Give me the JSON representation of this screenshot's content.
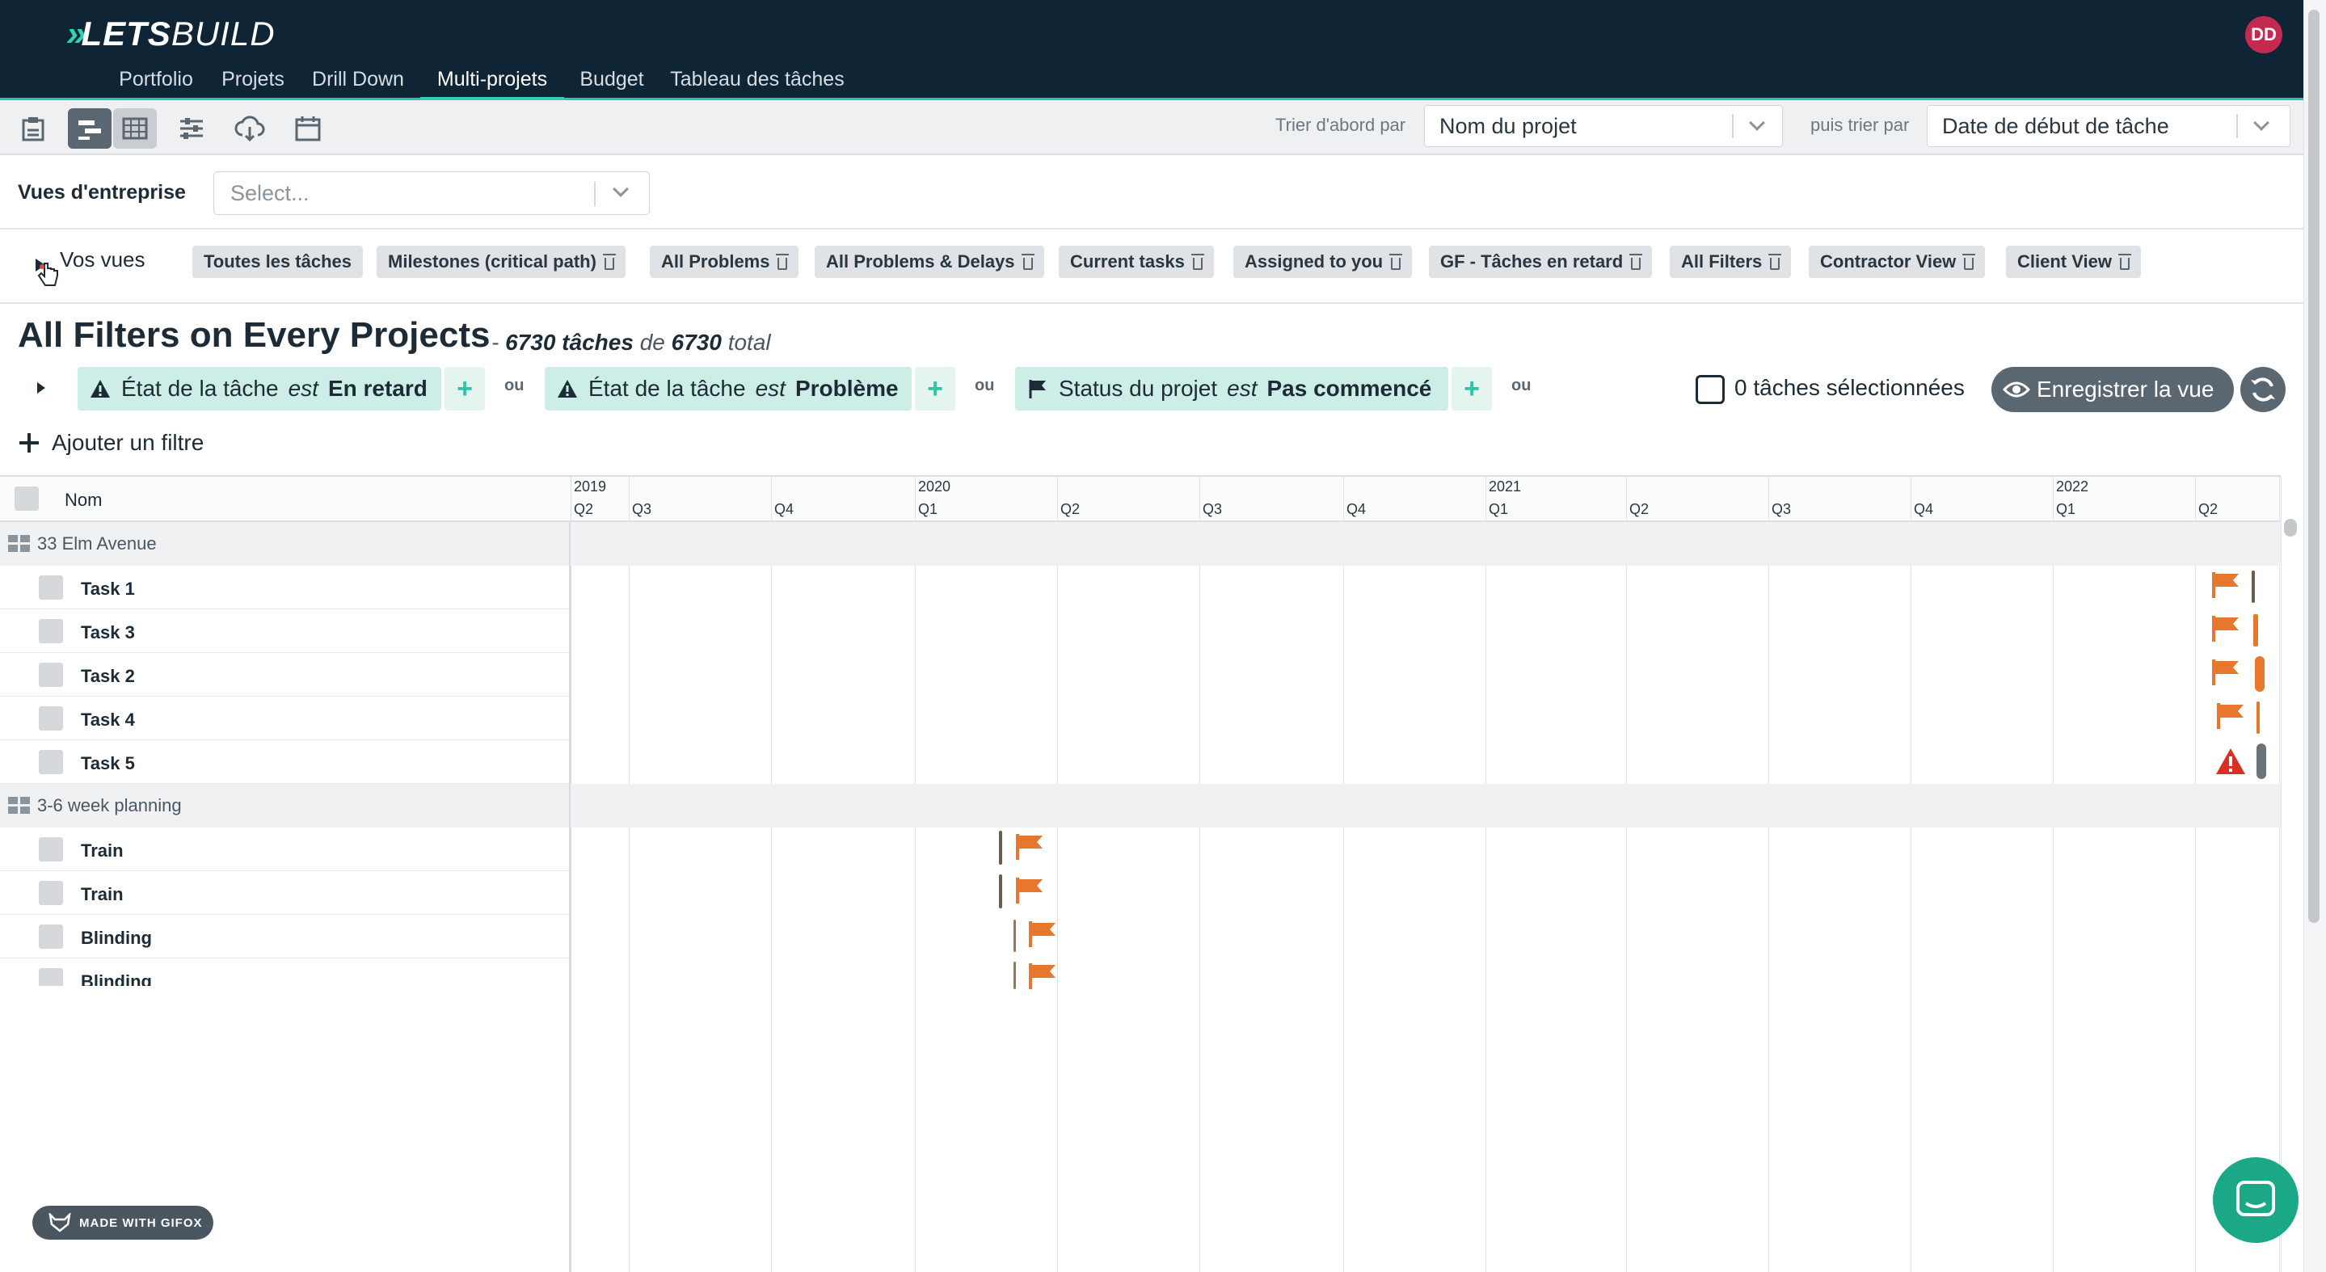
{
  "app": {
    "logo_mark": "»",
    "logo_text_bold": "LETS",
    "logo_text": "BUILD",
    "avatar_initials": "DD"
  },
  "nav": {
    "tabs": [
      {
        "label": "Portfolio",
        "active": false
      },
      {
        "label": "Projets",
        "active": false
      },
      {
        "label": "Drill Down",
        "active": false
      },
      {
        "label": "Multi-projets",
        "active": true
      },
      {
        "label": "Budget",
        "active": false
      },
      {
        "label": "Tableau des tâches",
        "active": false
      }
    ]
  },
  "toolbar": {
    "icons": [
      "clipboard-icon",
      "gantt-icon",
      "table-icon",
      "settings-sliders-icon",
      "cloud-download-icon",
      "calendar-icon"
    ],
    "sort_first_label": "Trier d'abord par",
    "sort_first_value": "Nom du projet",
    "sort_then_label": "puis trier par",
    "sort_then_value": "Date de début de tâche"
  },
  "company_views": {
    "label": "Vues d'entreprise",
    "placeholder": "Select..."
  },
  "your_views": {
    "label": "Vos vues",
    "chips": [
      {
        "label": "Toutes les tâches",
        "deletable": false
      },
      {
        "label": "Milestones (critical path)",
        "deletable": true
      },
      {
        "label": "All Problems",
        "deletable": true
      },
      {
        "label": "All Problems & Delays",
        "deletable": true
      },
      {
        "label": "Current tasks",
        "deletable": true
      },
      {
        "label": "Assigned to you",
        "deletable": true
      },
      {
        "label": "GF - Tâches en retard",
        "deletable": true
      },
      {
        "label": "All Filters",
        "deletable": true
      },
      {
        "label": "Contractor View",
        "deletable": true
      },
      {
        "label": "Client View",
        "deletable": true
      }
    ]
  },
  "page": {
    "title": "All Filters on Every Projects",
    "subtitle_dash": "-",
    "task_count": "6730 tâches",
    "de": "de",
    "total_count": "6730",
    "total_word": "total"
  },
  "filters": [
    {
      "field": "État de la tâche",
      "op": "est",
      "value": "En retard",
      "icon": "warning-icon"
    },
    {
      "field": "État de la tâche",
      "op": "est",
      "value": "Problème",
      "icon": "warning-icon"
    },
    {
      "field": "Status du projet",
      "op": "est",
      "value": "Pas commencé",
      "icon": "flag-icon"
    }
  ],
  "filter_join": "ou",
  "filter_add": "+",
  "selection": {
    "text": "0 tâches sélectionnées",
    "save_label": "Enregistrer la vue"
  },
  "add_filter_label": "Ajouter un filtre",
  "grid": {
    "name_header": "Nom",
    "years": [
      "2019",
      "2020",
      "2021",
      "2022"
    ],
    "quarters": [
      "Q2",
      "Q3",
      "Q4",
      "Q1",
      "Q2",
      "Q3",
      "Q4",
      "Q1",
      "Q2",
      "Q3",
      "Q4",
      "Q1",
      "Q2"
    ],
    "groups": [
      {
        "name": "33 Elm Avenue",
        "tasks": [
          {
            "name": "Task 1",
            "marker": "flag"
          },
          {
            "name": "Task 3",
            "marker": "flag"
          },
          {
            "name": "Task 2",
            "marker": "flag"
          },
          {
            "name": "Task 4",
            "marker": "flag"
          },
          {
            "name": "Task 5",
            "marker": "warning"
          }
        ]
      },
      {
        "name": "3-6 week planning",
        "tasks": [
          {
            "name": "Train",
            "marker": "flag"
          },
          {
            "name": "Train",
            "marker": "flag"
          },
          {
            "name": "Blinding",
            "marker": "flag"
          },
          {
            "name": "Blinding",
            "marker": "flag"
          }
        ]
      }
    ]
  },
  "badges": {
    "gifox": "MADE WITH GIFOX"
  },
  "colors": {
    "nav_bg": "#0f2435",
    "accent": "#2ec4a6",
    "flag": "#e8772e",
    "warning": "#d93025",
    "avatar": "#c42a4f"
  }
}
